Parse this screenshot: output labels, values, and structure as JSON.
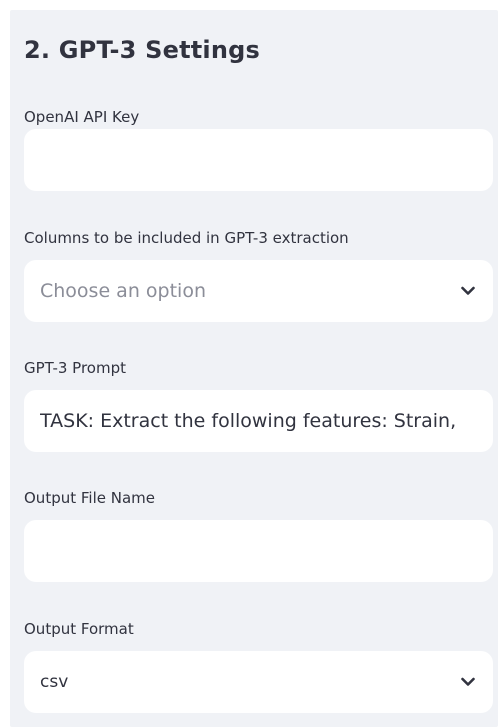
{
  "section": {
    "title": "2. GPT-3 Settings"
  },
  "api_key": {
    "label": "OpenAI API Key",
    "value": ""
  },
  "columns": {
    "label": "Columns to be included in GPT-3 extraction",
    "placeholder": "Choose an option",
    "icon": "chevron-down-icon"
  },
  "prompt": {
    "label": "GPT-3 Prompt",
    "value": "TASK: Extract the following features: Strain,"
  },
  "output_file": {
    "label": "Output File Name",
    "value": ""
  },
  "output_format": {
    "label": "Output Format",
    "selected": "csv",
    "icon": "chevron-down-icon"
  }
}
